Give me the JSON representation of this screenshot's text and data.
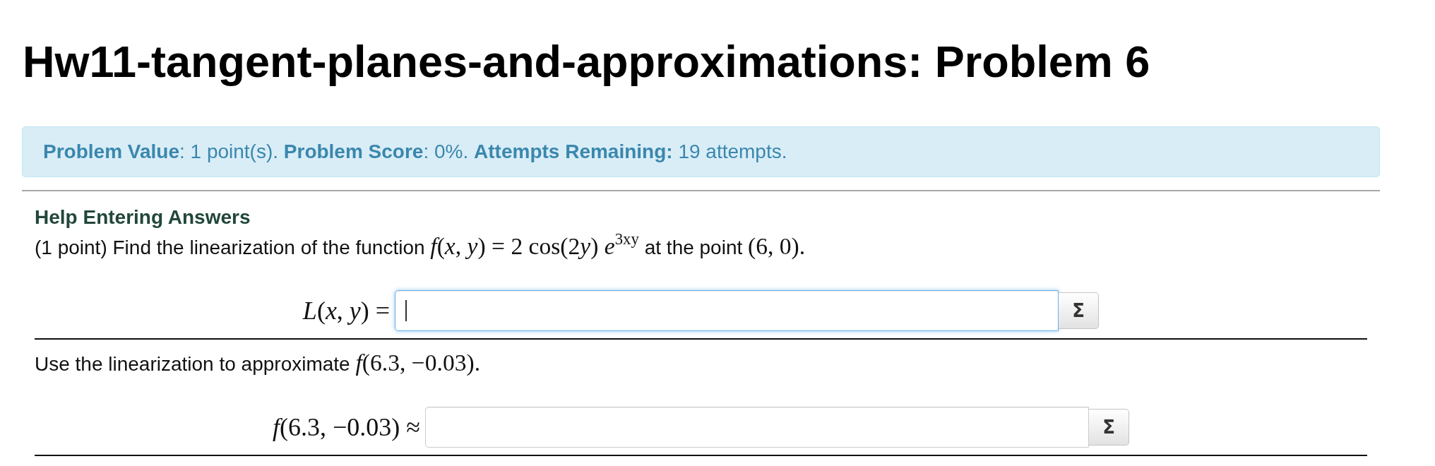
{
  "page_title": "Hw11-tangent-planes-and-approximations: Problem 6",
  "problem_info": "**Problem Value**: 1 point(s). **Problem Score**: 0%. **Attempts Remaining:** 19 attempts.",
  "help_link": "Help Entering Answers",
  "parts": [
    {
      "statement": [
        {
          "kind": "text",
          "text": "(1 point) Find the linearization of the function "
        },
        {
          "kind": "math",
          "text": "*f*(*x*, *y*) = 2 cos(2"
        },
        {
          "kind": "math",
          "text": "*y*) *e*$^{3xy}$"
        },
        {
          "kind": "text",
          "text": " at the point "
        },
        {
          "kind": "math",
          "text": "(6, 0)."
        }
      ],
      "answer": {
        "label": "*L*(*x*, *y*) =",
        "focused": true,
        "button": "Σ"
      }
    },
    {
      "statement": [
        {
          "kind": "text",
          "text": "Use the linearization to approximate "
        },
        {
          "kind": "math",
          "text": "*f*(6.3, −0.03)."
        }
      ],
      "answer": {
        "label": "*f*(6.3, −0.03) ≈",
        "focused": false,
        "button": "Σ"
      }
    }
  ]
}
